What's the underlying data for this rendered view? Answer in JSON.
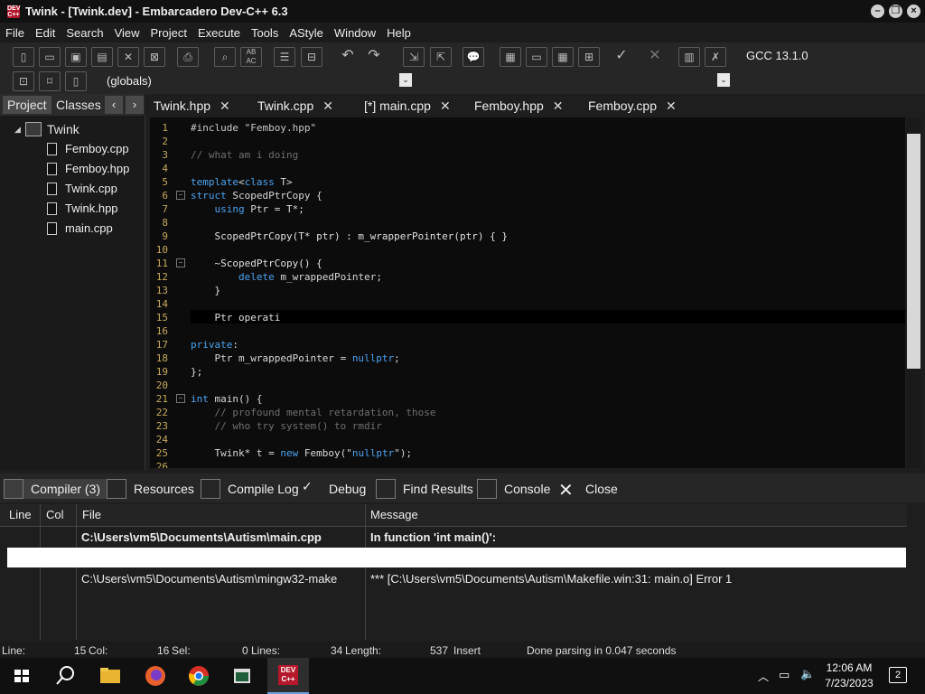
{
  "window": {
    "title": "Twink - [Twink.dev] - Embarcadero Dev-C++ 6.3"
  },
  "menu": [
    "File",
    "Edit",
    "Search",
    "View",
    "Project",
    "Execute",
    "Tools",
    "AStyle",
    "Window",
    "Help"
  ],
  "toolbar": {
    "compiler": "GCC 13.1.0",
    "scope": "(globals)"
  },
  "left_tabs": {
    "project": "Project",
    "classes": "Classes"
  },
  "tree": {
    "root": "Twink",
    "files": [
      "Femboy.cpp",
      "Femboy.hpp",
      "Twink.cpp",
      "Twink.hpp",
      "main.cpp"
    ]
  },
  "editor_tabs": [
    "Twink.hpp",
    "Twink.cpp",
    "[*] main.cpp",
    "Femboy.hpp",
    "Femboy.cpp"
  ],
  "code_lines": [
    "#include \"Femboy.hpp\"",
    "",
    "// what am i doing",
    "",
    "template<class T>",
    "struct ScopedPtrCopy {",
    "    using Ptr = T*;",
    "",
    "    ScopedPtrCopy(T* ptr) : m_wrapperPointer(ptr) { }",
    "",
    "    ~ScopedPtrCopy() {",
    "        delete m_wrappedPointer;",
    "    }",
    "",
    "    Ptr operati",
    "",
    "private:",
    "    Ptr m_wrappedPointer = nullptr;",
    "};",
    "",
    "int main() {",
    "    // profound mental retardation, those",
    "    // who try system() to rmdir",
    "",
    "    Twink* t = new Femboy(\"nullptr\");",
    ""
  ],
  "line_numbers": [
    "1",
    "2",
    "3",
    "4",
    "5",
    "6",
    "7",
    "8",
    "9",
    "10",
    "11",
    "12",
    "13",
    "14",
    "15",
    "16",
    "17",
    "18",
    "19",
    "20",
    "21",
    "22",
    "23",
    "24",
    "25",
    "26"
  ],
  "bottom_tabs": [
    "Compiler (3)",
    "Resources",
    "Compile Log",
    "Debug",
    "Find Results",
    "Console",
    "Close"
  ],
  "compiler_table": {
    "headers": [
      "Line",
      "Col",
      "File",
      "Message"
    ],
    "rows": [
      {
        "file": "C:\\Users\\vm5\\Documents\\Autism\\main.cpp",
        "message": "In function 'int main()':"
      },
      {
        "file": "",
        "message": ""
      },
      {
        "file": "C:\\Users\\vm5\\Documents\\Autism\\mingw32-make",
        "message": "*** [C:\\Users\\vm5\\Documents\\Autism\\Makefile.win:31: main.o] Error 1"
      }
    ]
  },
  "status": {
    "line_label": "Line:",
    "line": "15",
    "col_label": "Col:",
    "col": "16",
    "sel_label": "Sel:",
    "sel": "0",
    "lines_label": "Lines:",
    "lines": "34",
    "length_label": "Length:",
    "length": "537",
    "mode": "Insert",
    "message": "Done parsing in 0.047 seconds"
  },
  "taskbar": {
    "time": "12:06 AM",
    "date": "7/23/2023",
    "notifications": "2"
  },
  "colors": {
    "keyword": "#4aa3f0",
    "comment": "#6f6f6f",
    "string": "#d0d0d0",
    "linenum": "#c7a95a"
  }
}
